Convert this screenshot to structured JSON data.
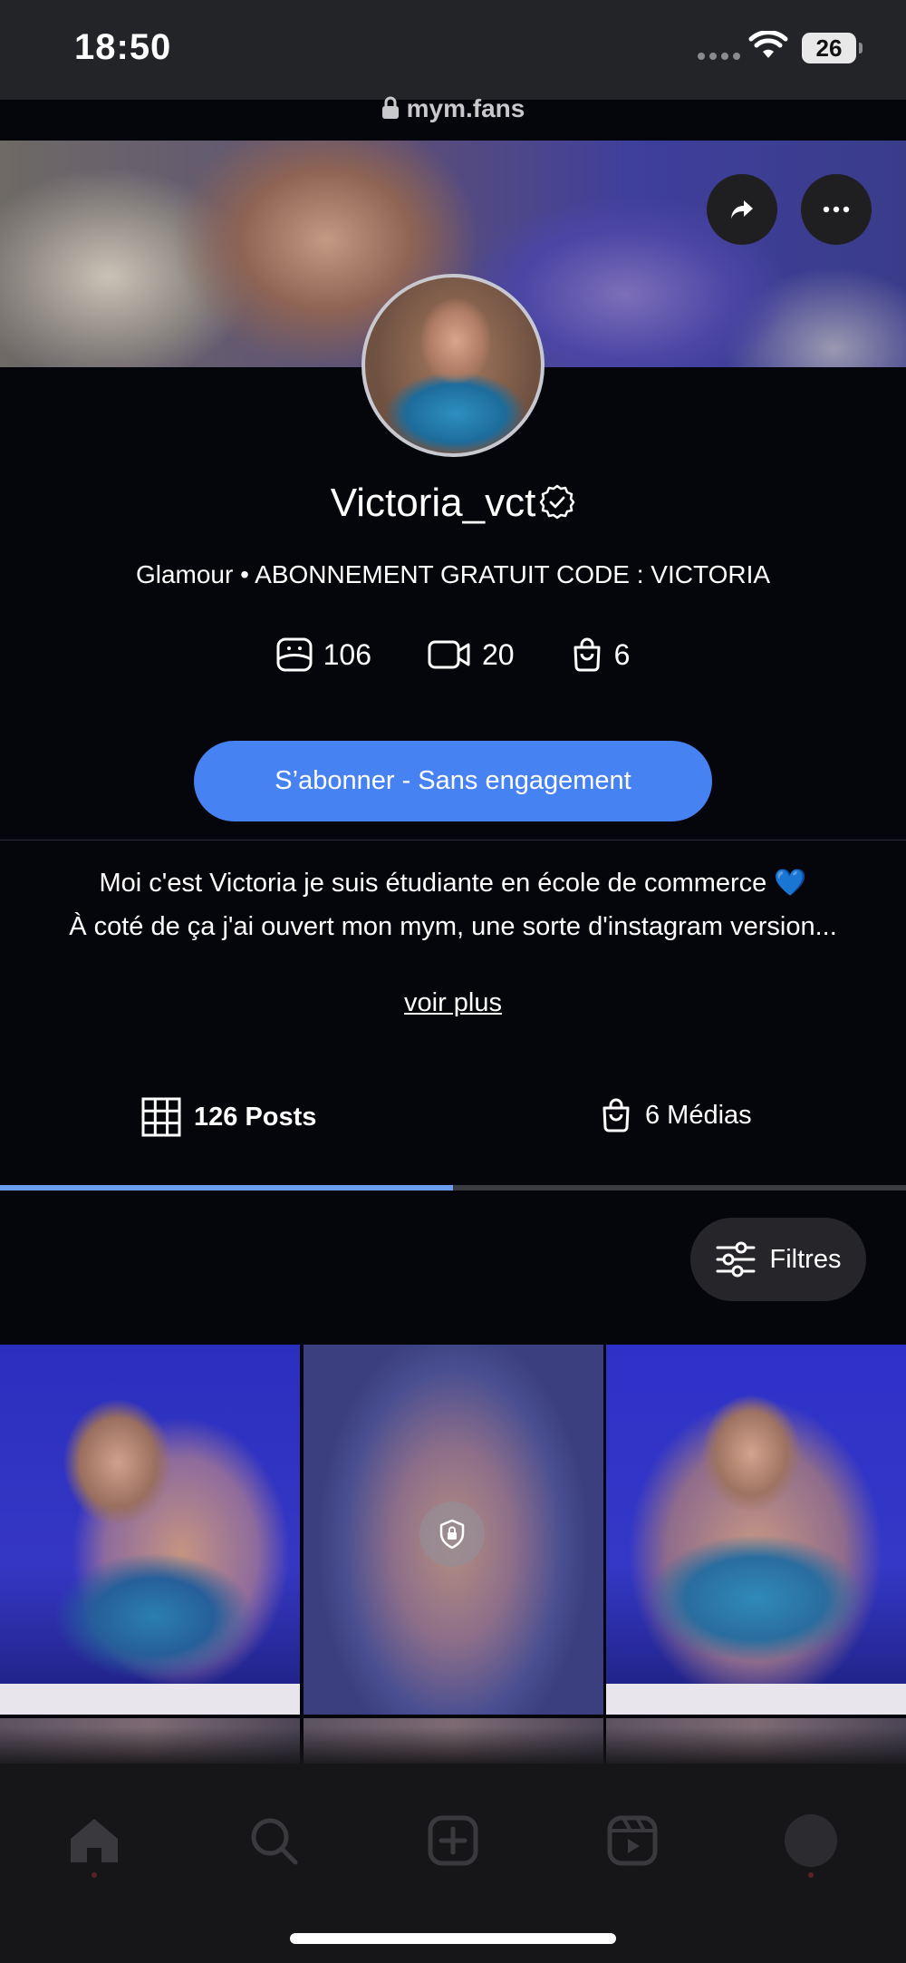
{
  "status_bar": {
    "time": "18:50",
    "battery": "26"
  },
  "browser": {
    "url": "mym.fans"
  },
  "profile": {
    "username": "Victoria_vct",
    "tagline": "Glamour • ABONNEMENT GRATUIT CODE : VICTORIA",
    "stats": {
      "photos": "106",
      "videos": "20",
      "medias": "6"
    },
    "subscribe_label": "S’abonner - Sans engagement",
    "bio_line1": "Moi c'est Victoria je suis étudiante en école de commerce",
    "bio_emoji": "💙",
    "bio_line2": "À coté de ça j'ai ouvert mon mym, une sorte d'instagram version...",
    "see_more": "voir plus"
  },
  "tabs": {
    "posts_label": "126 Posts",
    "media_label": "6 Médias",
    "active": "posts"
  },
  "filters_label": "Filtres",
  "colors": {
    "accent": "#4782f3",
    "tab_indicator": "#6d9ef0",
    "background": "#05050c"
  },
  "icons": {
    "share": "share-arrow-icon",
    "more": "more-dots-icon",
    "verified": "verified-badge-icon",
    "photos": "photo-frame-icon",
    "videos": "video-camera-icon",
    "medias": "shopping-bag-icon",
    "grid": "grid-icon",
    "filters": "sliders-icon",
    "lock": "lock-shield-icon",
    "nav": [
      "home-icon",
      "search-icon",
      "plus-square-icon",
      "reels-icon",
      "profile-icon"
    ]
  }
}
